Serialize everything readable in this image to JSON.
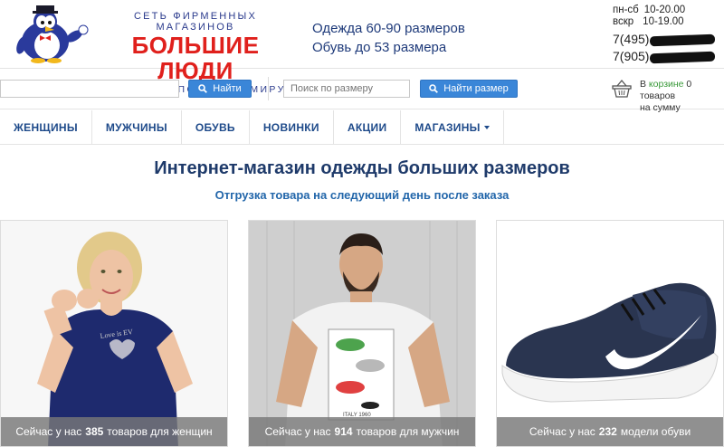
{
  "brand": {
    "top_line": "СЕТЬ ФИРМЕННЫХ МАГАЗИНОВ",
    "name": "БОЛЬШИЕ ЛЮДИ",
    "bottom_line": "ДОСТАВКА ПО ВСЕМУ МИРУ"
  },
  "tagline": {
    "line1": "Одежда 60-90 размеров",
    "line2": "Обувь до 53 размера"
  },
  "hours": {
    "weekdays_label": "пн-сб",
    "weekdays_time": "10-20.00",
    "sunday_label": "вскр",
    "sunday_time": "10-19.00"
  },
  "phones": {
    "phone1_prefix": "7(495)",
    "phone2_prefix": "7(905)"
  },
  "search": {
    "main_placeholder": "",
    "main_button": "Найти",
    "size_placeholder": "Поиск по размеру",
    "size_button": "Найти размер"
  },
  "cart": {
    "prefix": "В ",
    "link": "корзине",
    "count_text": " 0 товаров",
    "sum_text": "на сумму"
  },
  "nav": {
    "women": "ЖЕНЩИНЫ",
    "men": "МУЖЧИНЫ",
    "shoes": "ОБУВЬ",
    "new": "НОВИНКИ",
    "sales": "АКЦИИ",
    "stores": "МАГАЗИНЫ"
  },
  "headline": "Интернет-магазин одежды больших размеров",
  "subheadline": "Отгрузка товара на следующий день после заказа",
  "cards": [
    {
      "pre": "Сейчас у нас",
      "count": "385",
      "post": "товаров для женщин"
    },
    {
      "pre": "Сейчас у нас",
      "count": "914",
      "post": "товаров для мужчин"
    },
    {
      "pre": "Сейчас у нас",
      "count": "232",
      "post": "модели обуви"
    }
  ],
  "card_images": {
    "tee_print": "ITALY 1960",
    "shirt_text": "Love is EV"
  },
  "colors": {
    "brand_red": "#e0201c",
    "brand_blue": "#2a3a8c",
    "nav_blue": "#1e4a8a",
    "button_blue": "#3a86d8",
    "cart_green": "#3a9a3a"
  },
  "icons": {
    "search": "search-icon",
    "cart": "basket-icon",
    "mascot": "penguin-logo"
  }
}
